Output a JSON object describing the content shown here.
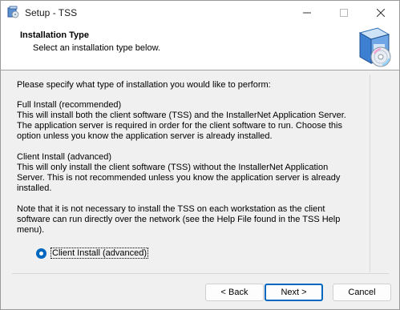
{
  "window": {
    "title": "Setup - TSS",
    "controls": {
      "minimize": "—",
      "maximize": "☐",
      "close": "✕"
    }
  },
  "header": {
    "title": "Installation Type",
    "subtitle": "Select an installation type below."
  },
  "body": {
    "intro": "Please specify what type of installation you would like to perform:",
    "full_install": "Full Install (recommended)\nThis will install both the client software (TSS) and the InstallerNet Application Server.\nThe application server is required in order for the client software to run. Choose this\noption unless you know the application server is already installed.",
    "client_install": "Client Install (advanced)\nThis will only install the client software (TSS) without the InstallerNet Application\nServer. This is not recommended unless you know the application server is already\ninstalled.",
    "note": "Note that it is not necessary to install the TSS on each workstation as the client\nsoftware can run directly over the network (see the Help File found in the TSS Help\nmenu)."
  },
  "options": {
    "selected_label": "Client Install (advanced)"
  },
  "buttons": {
    "back": "< Back",
    "next": "Next >",
    "cancel": "Cancel"
  },
  "colors": {
    "accent": "#0067c0",
    "header_bg": "#ffffff",
    "dialog_bg": "#f0f0f0"
  },
  "icons": {
    "app": "setup-app-icon",
    "banner": "setup-box-cd-icon"
  }
}
